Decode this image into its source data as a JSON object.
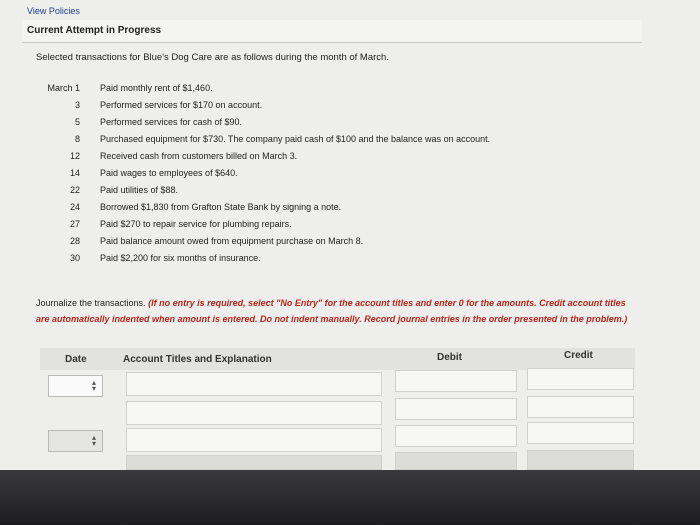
{
  "header": {
    "view_policies": "View Policies",
    "attempt_title": "Current Attempt in Progress"
  },
  "problem": {
    "intro": "Selected transactions for Blue's Dog Care are as follows during the month of March.",
    "transactions": [
      {
        "date": "March 1",
        "text": "Paid monthly rent of $1,460."
      },
      {
        "date": "3",
        "text": "Performed services for $170 on account."
      },
      {
        "date": "5",
        "text": "Performed services for cash of $90."
      },
      {
        "date": "8",
        "text": "Purchased equipment for $730. The company paid cash of $100 and the balance was on account."
      },
      {
        "date": "12",
        "text": "Received cash from customers billed on March 3."
      },
      {
        "date": "14",
        "text": "Paid wages to employees of $640."
      },
      {
        "date": "22",
        "text": "Paid utilities of $88."
      },
      {
        "date": "24",
        "text": "Borrowed $1,830 from Grafton State Bank by signing a note."
      },
      {
        "date": "27",
        "text": "Paid $270 to repair service for plumbing repairs."
      },
      {
        "date": "28",
        "text": "Paid balance amount owed from equipment purchase on March 8."
      },
      {
        "date": "30",
        "text": "Paid $2,200 for six months of insurance."
      }
    ]
  },
  "instructions": {
    "lead": "Journalize the transactions.",
    "body": "(If no entry is required, select \"No Entry\" for the account titles and enter 0 for the amounts. Credit account titles are automatically indented when amount is entered. Do not indent manually. Record journal entries in the order presented in the problem.)"
  },
  "journal": {
    "col_date": "Date",
    "col_account": "Account Titles and Explanation",
    "col_debit": "Debit",
    "col_credit": "Credit"
  }
}
